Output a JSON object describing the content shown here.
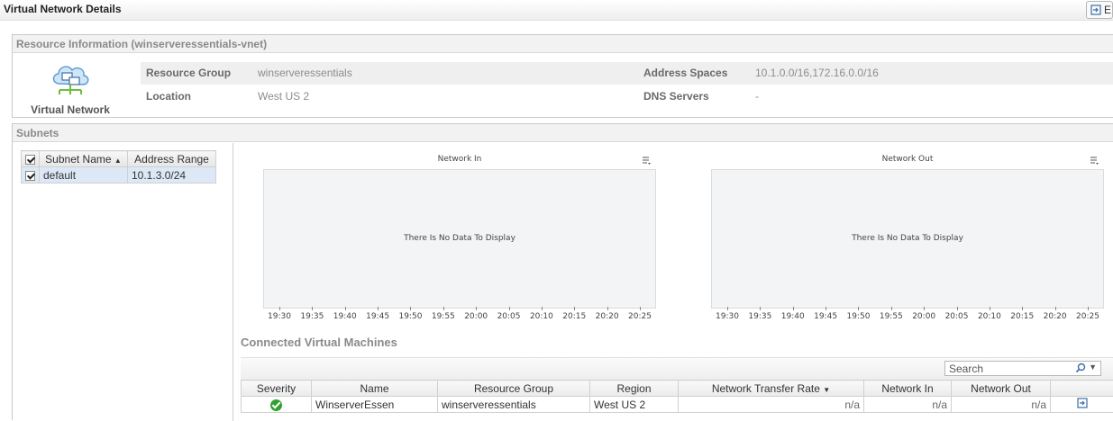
{
  "page": {
    "title": "Virtual Network Details",
    "export_label": "E"
  },
  "resource": {
    "header": "Resource Information (winserveressentials-vnet)",
    "icon_label": "Virtual Network",
    "rows": [
      {
        "k1": "Resource Group",
        "v1": "winserveressentials",
        "k2": "Address Spaces",
        "v2": "10.1.0.0/16,172.16.0.0/16"
      },
      {
        "k1": "Location",
        "v1": "West US 2",
        "k2": "DNS Servers",
        "v2": "-"
      }
    ]
  },
  "subnets": {
    "header": "Subnets",
    "columns": [
      "Subnet Name",
      "Address Range"
    ],
    "rows": [
      {
        "name": "default",
        "range": "10.1.3.0/24"
      }
    ]
  },
  "charts": {
    "no_data": "There Is No Data To Display",
    "ticks": [
      "19:30",
      "19:35",
      "19:40",
      "19:45",
      "19:50",
      "19:55",
      "20:00",
      "20:05",
      "20:10",
      "20:15",
      "20:20",
      "20:25"
    ],
    "titles": [
      "Network In",
      "Network Out"
    ]
  },
  "chart_data": [
    {
      "type": "line",
      "title": "Network In",
      "x": [
        "19:30",
        "19:35",
        "19:40",
        "19:45",
        "19:50",
        "19:55",
        "20:00",
        "20:05",
        "20:10",
        "20:15",
        "20:20",
        "20:25"
      ],
      "series": []
    },
    {
      "type": "line",
      "title": "Network Out",
      "x": [
        "19:30",
        "19:35",
        "19:40",
        "19:45",
        "19:50",
        "19:55",
        "20:00",
        "20:05",
        "20:10",
        "20:15",
        "20:20",
        "20:25"
      ],
      "series": []
    }
  ],
  "vms": {
    "title": "Connected Virtual Machines",
    "search_placeholder": "Search",
    "columns": [
      "Severity",
      "Name",
      "Resource Group",
      "Region",
      "Network Transfer Rate",
      "Network In",
      "Network Out"
    ],
    "rows": [
      {
        "name": "WinserverEssen",
        "resource_group": "winserveressentials",
        "region": "West US 2",
        "transfer_rate": "n/a",
        "net_in": "n/a",
        "net_out": "n/a"
      }
    ]
  }
}
